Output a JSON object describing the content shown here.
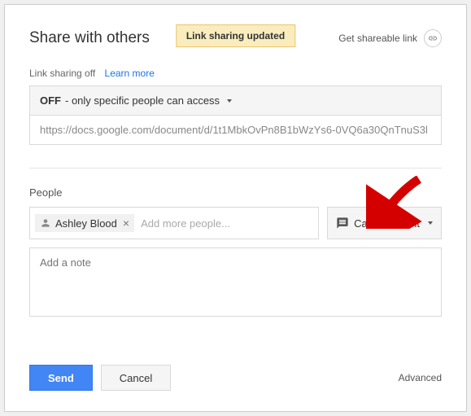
{
  "header": {
    "title": "Share with others",
    "banner": "Link sharing updated",
    "get_link_label": "Get shareable link"
  },
  "link_section": {
    "status_label": "Link sharing off",
    "learn_more": "Learn more",
    "access_bold": "OFF",
    "access_rest": " - only specific people can access",
    "url": "https://docs.google.com/document/d/1t1MbkOvPn8B1bWzYs6-0VQ6a30QnTnuS3l"
  },
  "people": {
    "label": "People",
    "chip_name": "Ashley Blood",
    "placeholder": "Add more people...",
    "permission_label": "Can comment",
    "note_placeholder": "Add a note"
  },
  "footer": {
    "send": "Send",
    "cancel": "Cancel",
    "advanced": "Advanced"
  }
}
